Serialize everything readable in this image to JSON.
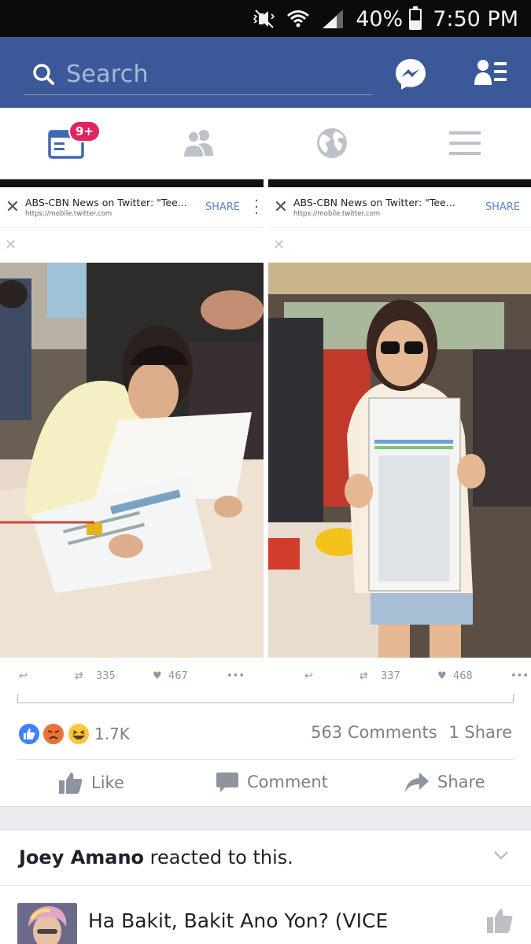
{
  "status_bar": {
    "battery": "40%",
    "battery_level": 0.4,
    "time": "7:50 PM"
  },
  "search": {
    "placeholder": "Search"
  },
  "tabs": {
    "notifications_badge": "9+"
  },
  "post_images": [
    {
      "tweet_title": "ABS-CBN News on Twitter: \"Tee...",
      "tweet_url": "https://mobile.twitter.com",
      "share_label": "SHARE",
      "retweets": "335",
      "likes": "467"
    },
    {
      "tweet_title": "ABS-CBN News on Twitter: \"Tee...",
      "tweet_url": "https://mobile.twitter.com",
      "share_label": "SHARE",
      "retweets": "337",
      "likes": "468"
    }
  ],
  "post": {
    "reaction_count": "1.7K",
    "comments": "563 Comments",
    "shares": "1 Share",
    "actions": {
      "like": "Like",
      "comment": "Comment",
      "share": "Share"
    }
  },
  "activity": {
    "name": "Joey Amano",
    "text": " reacted to this."
  },
  "next_post": {
    "title": "Ha Bakit, Bakit Ano Yon? (VICE"
  },
  "colors": {
    "facebook_blue": "#3b5998",
    "notification_red": "#e0245e",
    "like_blue": "#4080ff"
  }
}
